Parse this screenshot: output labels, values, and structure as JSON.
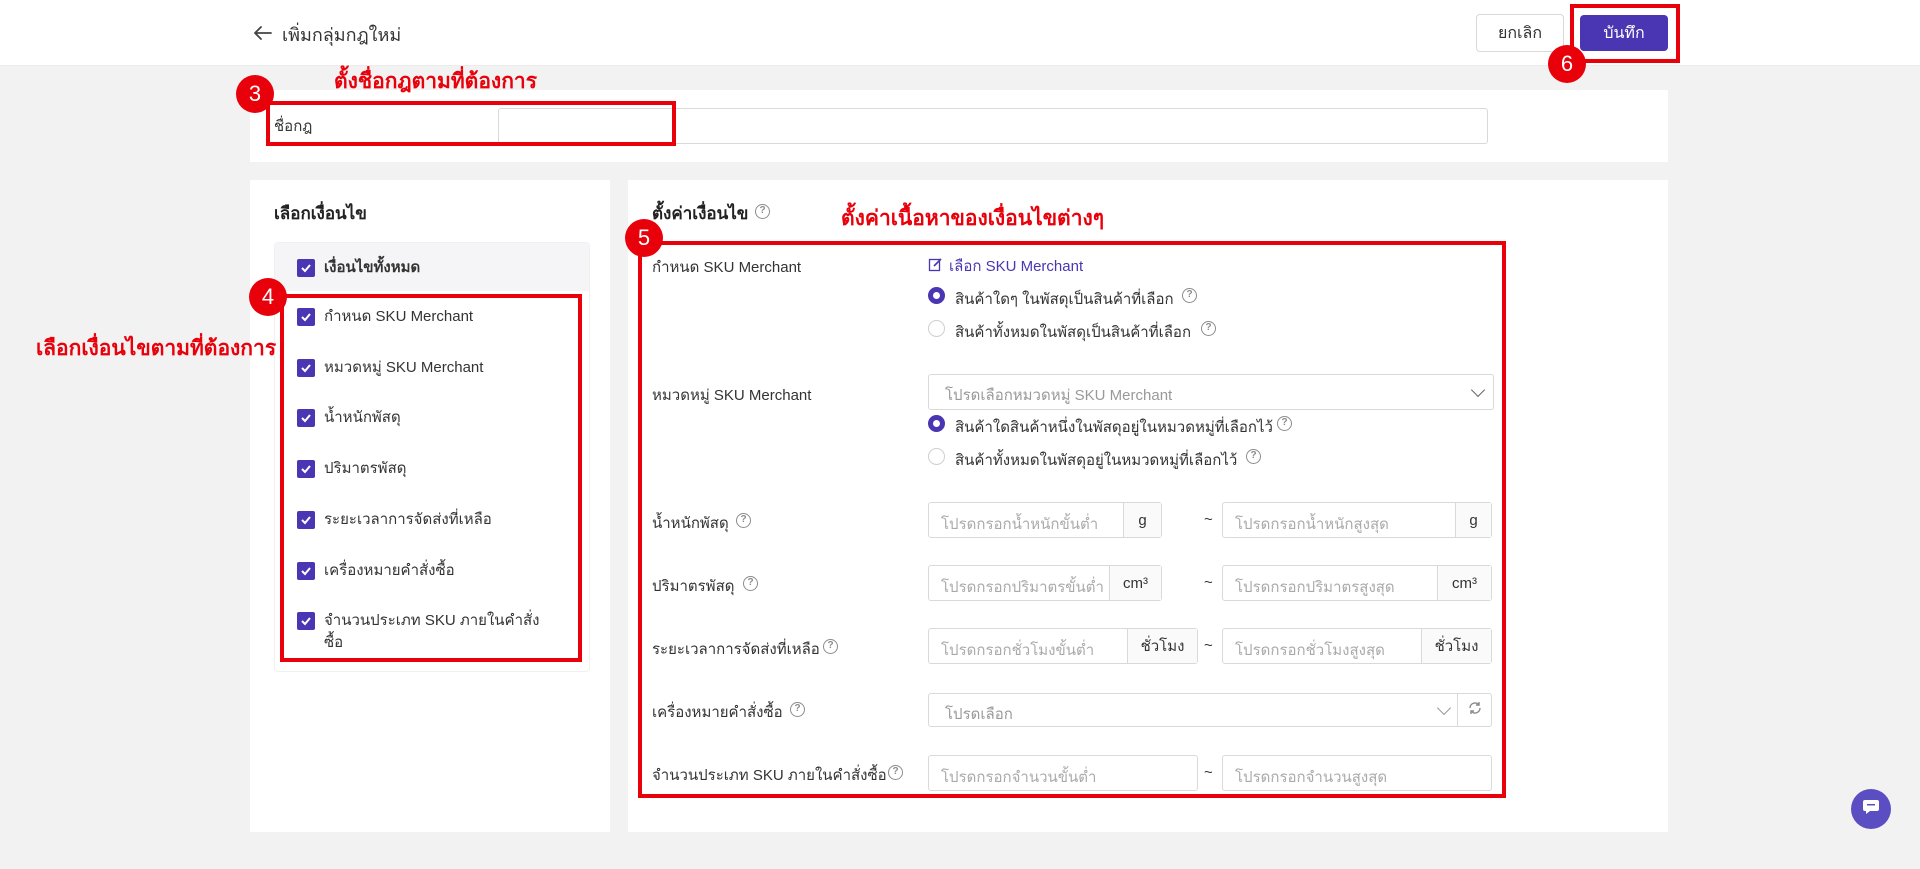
{
  "header": {
    "title": "เพิ่มกลุ่มกฎใหม่",
    "cancel_label": "ยกเลิก",
    "save_label": "บันทึก"
  },
  "rule_name": {
    "label": "ชื่อกฎ",
    "value": ""
  },
  "conditions_panel": {
    "title": "เลือกเงื่อนไข",
    "all_label": "เงื่อนไขทั้งหมด",
    "items": [
      {
        "label": "กำหนด SKU Merchant",
        "checked": true
      },
      {
        "label": "หมวดหมู่ SKU Merchant",
        "checked": true
      },
      {
        "label": "น้ำหนักพัสดุ",
        "checked": true
      },
      {
        "label": "ปริมาตรพัสดุ",
        "checked": true
      },
      {
        "label": "ระยะเวลาการจัดส่งที่เหลือ",
        "checked": true
      },
      {
        "label": "เครื่องหมายคำสั่งซื้อ",
        "checked": true
      },
      {
        "label": "จำนวนประเภท SKU ภายในคำสั่ง",
        "label2": "ซื้อ",
        "checked": true
      }
    ]
  },
  "settings_panel": {
    "title": "ตั้งค่าเงื่อนไข",
    "sku": {
      "label": "กำหนด SKU Merchant",
      "link": "เลือก SKU Merchant",
      "options": [
        "สินค้าใดๆ ในพัสดุเป็นสินค้าที่เลือก",
        "สินค้าทั้งหมดในพัสดุเป็นสินค้าที่เลือก"
      ],
      "selected": 0
    },
    "category": {
      "label": "หมวดหมู่ SKU Merchant",
      "placeholder": "โปรดเลือกหมวดหมู่ SKU Merchant",
      "options": [
        "สินค้าใดสินค้าหนึ่งในพัสดุอยู่ในหมวดหมู่ที่เลือกไว้",
        "สินค้าทั้งหมดในพัสดุอยู่ในหมวดหมู่ที่เลือกไว้"
      ],
      "selected": 0
    },
    "weight": {
      "label": "น้ำหนักพัสดุ",
      "min_placeholder": "โปรดกรอกน้ำหนักขั้นต่ำ",
      "max_placeholder": "โปรดกรอกน้ำหนักสูงสุด",
      "unit": "g"
    },
    "volume": {
      "label": "ปริมาตรพัสดุ",
      "min_placeholder": "โปรดกรอกปริมาตรขั้นต่ำ",
      "max_placeholder": "โปรดกรอกปริมาตรสูงสุด",
      "unit": "cm³"
    },
    "shipping_time": {
      "label": "ระยะเวลาการจัดส่งที่เหลือ",
      "min_placeholder": "โปรดกรอกชั่วโมงขั้นต่ำ",
      "max_placeholder": "โปรดกรอกชั่วโมงสูงสุด",
      "unit": "ชั่วโมง"
    },
    "order_mark": {
      "label": "เครื่องหมายคำสั่งซื้อ",
      "placeholder": "โปรดเลือก"
    },
    "sku_count": {
      "label": "จำนวนประเภท SKU ภายในคำสั่งซื้อ",
      "min_placeholder": "โปรดกรอกจำนวนขั้นต่ำ",
      "max_placeholder": "โปรดกรอกจำนวนสูงสุด"
    },
    "tilde": "~",
    "help_glyph": "?"
  },
  "annotations": {
    "note_name": "ตั้งชื่อกฎตามที่ต้องการ",
    "note_conditions": "เลือกเงื่อนไขตามที่ต้องการ",
    "note_settings": "ตั้งค่าเนื้อหาของเงื่อนไขต่างๆ",
    "badges": [
      "3",
      "4",
      "5",
      "6"
    ]
  },
  "colors": {
    "accent": "#4a36b3",
    "annotation": "#e8000b"
  }
}
